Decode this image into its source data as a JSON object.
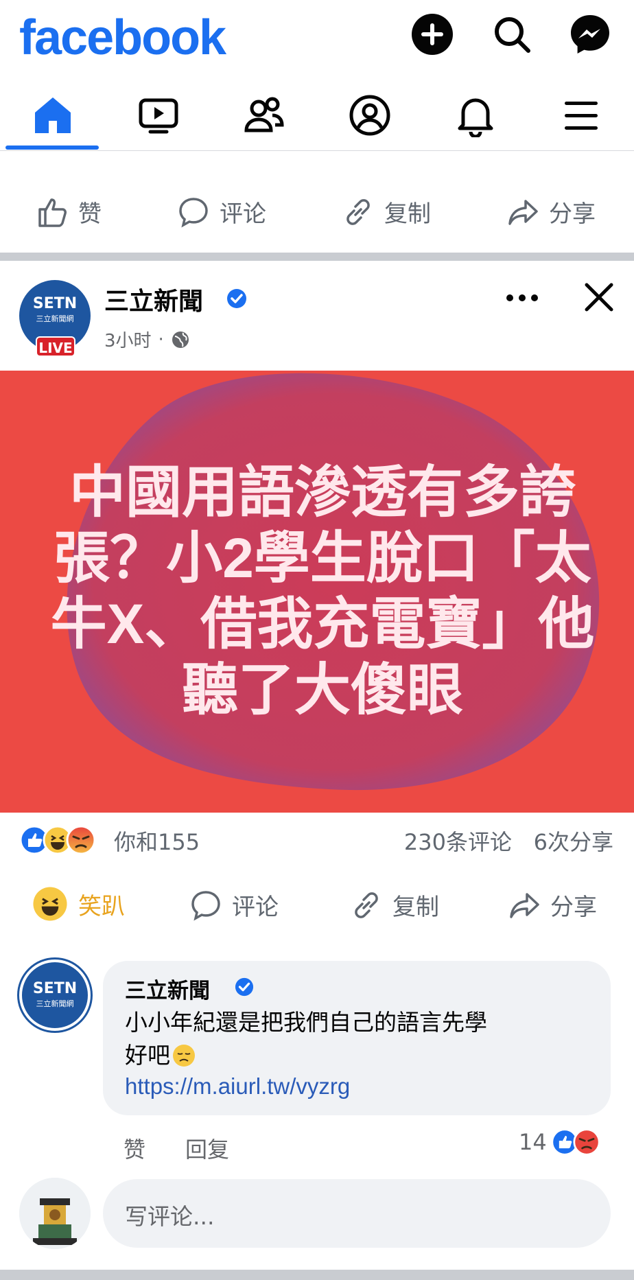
{
  "app": {
    "logo_text": "facebook",
    "brand_color": "#1b6ff0"
  },
  "top_icons": [
    "plus-icon",
    "search-icon",
    "messenger-icon"
  ],
  "tabs": [
    {
      "name": "home",
      "active": true
    },
    {
      "name": "watch",
      "active": false
    },
    {
      "name": "friends",
      "active": false
    },
    {
      "name": "profile",
      "active": false
    },
    {
      "name": "notifications",
      "active": false
    },
    {
      "name": "menu",
      "active": false
    }
  ],
  "prev_post": {
    "actions": {
      "like": "赞",
      "comment": "评论",
      "copy": "复制",
      "share": "分享"
    }
  },
  "post": {
    "author": "三立新聞",
    "verified": true,
    "time": "3小时",
    "dot": "·",
    "avatar_text": "SETN",
    "avatar_sub": "三立新聞網",
    "live_badge": "LIVE",
    "image_colors": {
      "bg": "#ec4a44",
      "blob": "#c93d5a",
      "text": "#ffe8ec"
    },
    "headline": [
      "中國用語滲透有多誇",
      "張？小2學生脫口「太",
      "牛X、借我充電寶」他",
      "聽了大傻眼"
    ],
    "reactions_text": "你和155",
    "comments_count": "230条评论",
    "shares_count": "6次分享",
    "actions": {
      "reaction": "笑趴",
      "comment": "评论",
      "copy": "复制",
      "share": "分享"
    }
  },
  "comment": {
    "author": "三立新聞",
    "text_line1": "小小年紀還是把我們自己的語言先學",
    "text_line2": "好吧",
    "link": "https://m.aiurl.tw/vyzrg",
    "like_label": "赞",
    "reply_label": "回复",
    "reaction_count": "14"
  },
  "composer": {
    "placeholder": "写评论..."
  }
}
